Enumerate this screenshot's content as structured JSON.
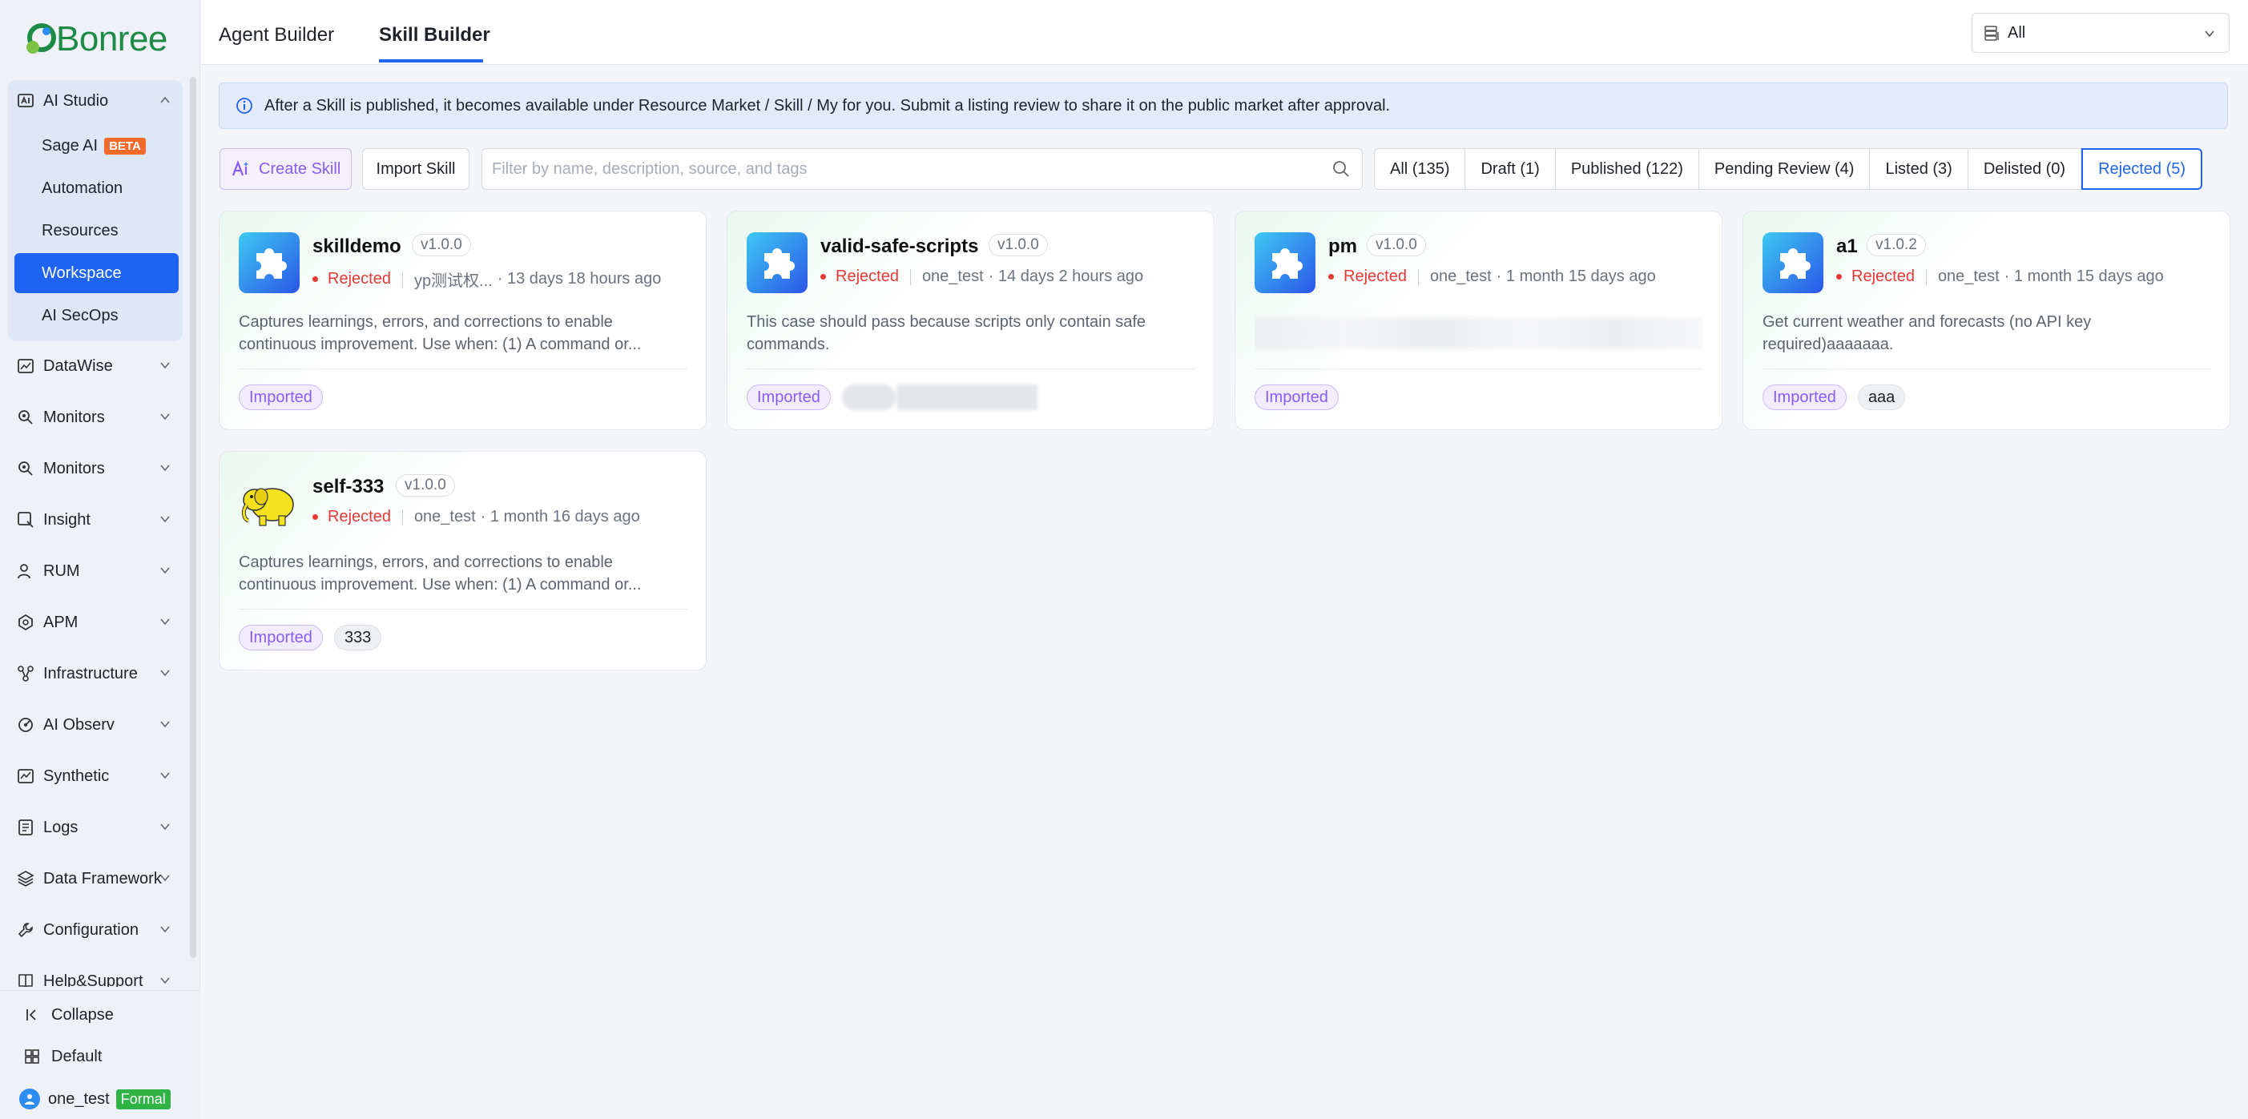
{
  "brand": {
    "name": "Bonree"
  },
  "sidebar": {
    "groups": [
      {
        "label": "AI Studio",
        "icon": "ai-studio-icon",
        "expanded": true,
        "children": [
          {
            "label": "Sage AI",
            "badge": "BETA"
          },
          {
            "label": "Automation"
          },
          {
            "label": "Resources"
          },
          {
            "label": "Workspace",
            "active": true
          },
          {
            "label": "AI SecOps"
          }
        ]
      },
      {
        "label": "DataWise",
        "icon": "chart-icon"
      },
      {
        "label": "Monitors",
        "icon": "monitor-icon"
      },
      {
        "label": "Monitors",
        "icon": "monitor-icon"
      },
      {
        "label": "Insight",
        "icon": "search-icon"
      },
      {
        "label": "RUM",
        "icon": "user-icon"
      },
      {
        "label": "APM",
        "icon": "apm-icon"
      },
      {
        "label": "Infrastructure",
        "icon": "infrastructure-icon"
      },
      {
        "label": "AI Observ",
        "icon": "ai-observ-icon"
      },
      {
        "label": "Synthetic",
        "icon": "synthetic-icon"
      },
      {
        "label": "Logs",
        "icon": "logs-icon"
      },
      {
        "label": "Data Framework",
        "icon": "data-framework-icon"
      },
      {
        "label": "Configuration",
        "icon": "wrench-icon"
      },
      {
        "label": "Help&Support",
        "icon": "book-icon"
      }
    ],
    "bottom": {
      "collapse": "Collapse",
      "default": "Default",
      "user": "one_test",
      "user_badge": "Formal"
    }
  },
  "header": {
    "tabs": [
      {
        "label": "Agent Builder",
        "active": false
      },
      {
        "label": "Skill Builder",
        "active": true
      }
    ],
    "env_select": "All"
  },
  "banner": {
    "text": "After a Skill is published, it becomes available under Resource Market / Skill / My for you. Submit a listing review to share it on the public market after approval."
  },
  "toolbar": {
    "create": "Create Skill",
    "import": "Import Skill",
    "search_placeholder": "Filter by name, description, source, and tags",
    "filters": [
      {
        "label": "All (135)"
      },
      {
        "label": "Draft (1)"
      },
      {
        "label": "Published (122)"
      },
      {
        "label": "Pending Review (4)"
      },
      {
        "label": "Listed (3)"
      },
      {
        "label": "Delisted (0)"
      },
      {
        "label": "Rejected (5)",
        "active": true
      }
    ]
  },
  "cards": [
    {
      "name": "skilldemo",
      "version": "v1.0.0",
      "status": "Rejected",
      "owner": "yp测试权...",
      "time": "· 13 days 18 hours ago",
      "icon": "puzzle-icon",
      "description": "Captures learnings, errors, and corrections to enable continuous improvement. Use when: (1) A command or...",
      "tags": [
        "Imported"
      ]
    },
    {
      "name": "valid-safe-scripts",
      "version": "v1.0.0",
      "status": "Rejected",
      "owner": "one_test",
      "time": "· 14 days 2 hours ago",
      "icon": "puzzle-icon",
      "description": "This case should pass because scripts only contain safe commands.",
      "tags": [
        "Imported"
      ]
    },
    {
      "name": "pm",
      "version": "v1.0.0",
      "status": "Rejected",
      "owner": "one_test",
      "time": "· 1 month 15 days ago",
      "icon": "puzzle-icon",
      "description": "",
      "tags": [
        "Imported"
      ]
    },
    {
      "name": "a1",
      "version": "v1.0.2",
      "status": "Rejected",
      "owner": "one_test",
      "time": "· 1 month 15 days ago",
      "icon": "puzzle-icon",
      "description": "Get current weather and forecasts (no API key required)aaaaaaa.",
      "tags": [
        "Imported",
        "aaa"
      ]
    },
    {
      "name": "self-333",
      "version": "v1.0.0",
      "status": "Rejected",
      "owner": "one_test",
      "time": "· 1 month 16 days ago",
      "icon": "elephant-icon",
      "description": "Captures learnings, errors, and corrections to enable continuous improvement. Use when: (1) A command or...",
      "tags": [
        "Imported",
        "333"
      ]
    }
  ],
  "colors": {
    "accent": "#1e64f0",
    "rejected": "#e53935",
    "imported": "#8a5cf6",
    "brand": "#1d8a45"
  }
}
